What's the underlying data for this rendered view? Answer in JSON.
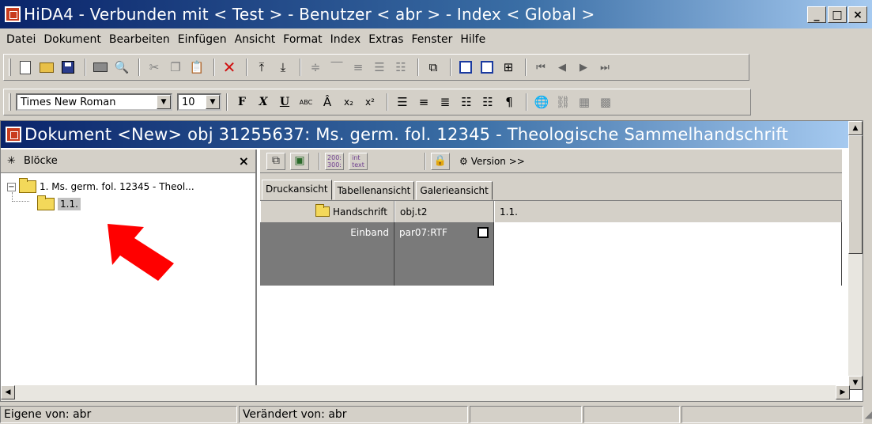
{
  "window": {
    "title": "HiDA4 - Verbunden mit < Test > - Benutzer < abr > - Index < Global >",
    "minimize": "_",
    "maximize": "□",
    "close": "×"
  },
  "menu": [
    "Datei",
    "Dokument",
    "Bearbeiten",
    "Einfügen",
    "Ansicht",
    "Format",
    "Index",
    "Extras",
    "Fenster",
    "Hilfe"
  ],
  "format_toolbar": {
    "font": "Times New Roman",
    "size": "10",
    "bold": "F",
    "italic": "X",
    "underline": "U",
    "abc": "ABC",
    "subscript": "x₂",
    "superscript": "x²",
    "pilcrow": "¶"
  },
  "document": {
    "title": "Dokument <New> obj 31255637: Ms. germ. fol. 12345 - Theologische Sammelhandschrift",
    "left_pane": {
      "header": "Blöcke",
      "header_icon": "✳",
      "close": "×",
      "tree": [
        {
          "label": "1. Ms. germ. fol. 12345 - Theol...",
          "toggle": "−"
        },
        {
          "label": "1.1."
        }
      ]
    },
    "right_toolbar": {
      "res_label": "200:\n300:",
      "int_label": "int\ntext",
      "version_label": "Version >>"
    },
    "tabs": [
      "Druckansicht",
      "Tabellenansicht",
      "Galerieansicht"
    ],
    "grid": {
      "headers": [
        "Handschrift",
        "obj.t2",
        "1.1."
      ],
      "row": {
        "label": "Einband",
        "field": "par07:RTF",
        "value": ""
      }
    }
  },
  "status": [
    "Eigene von: abr",
    "Verändert von: abr",
    "",
    "",
    ""
  ],
  "colors": {
    "title_start": "#0a246a",
    "title_end": "#a6caf0",
    "arrow": "#ff0000",
    "grid_dark": "#7a7a7a"
  }
}
